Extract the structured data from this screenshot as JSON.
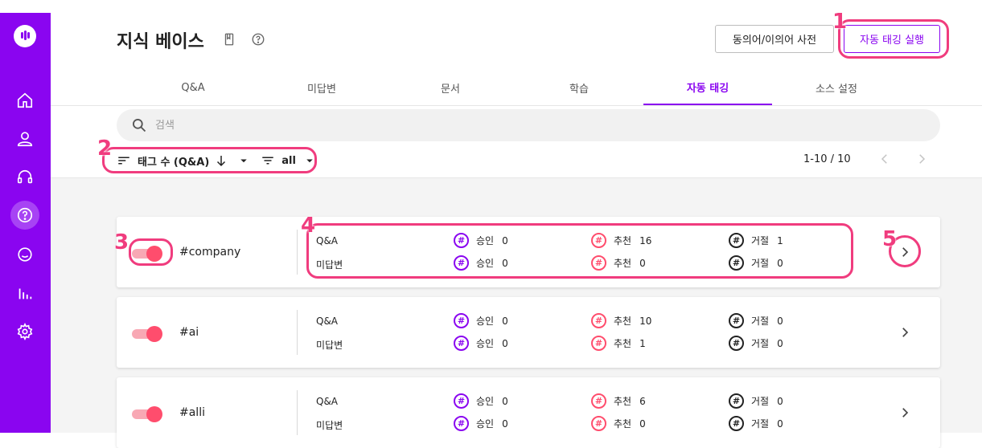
{
  "header": {
    "title": "지식 베이스",
    "synonym_button": "동의어/이의어 사전",
    "autotag_button": "자동 태깅 실행"
  },
  "tabs": [
    "Q&A",
    "미답변",
    "문서",
    "학습",
    "자동 태깅",
    "소스 설정"
  ],
  "active_tab": "자동 태깅",
  "search": {
    "placeholder": "검색"
  },
  "filters": {
    "sort_label": "태그 수 (Q&A)",
    "status_label": "all"
  },
  "pagination": {
    "range": "1-10 / 10"
  },
  "stat_labels": {
    "approve": "승인",
    "recommend": "추천",
    "reject": "거절"
  },
  "row_labels": {
    "qa": "Q&A",
    "unanswered": "미답변"
  },
  "tags": [
    {
      "name": "#company",
      "enabled": true,
      "qa": {
        "approve": "0",
        "recommend": "16",
        "reject": "1"
      },
      "unanswered": {
        "approve": "0",
        "recommend": "0",
        "reject": "0"
      }
    },
    {
      "name": "#ai",
      "enabled": true,
      "qa": {
        "approve": "0",
        "recommend": "10",
        "reject": "0"
      },
      "unanswered": {
        "approve": "0",
        "recommend": "1",
        "reject": "0"
      }
    },
    {
      "name": "#alli",
      "enabled": true,
      "qa": {
        "approve": "0",
        "recommend": "6",
        "reject": "0"
      },
      "unanswered": {
        "approve": "0",
        "recommend": "0",
        "reject": "0"
      }
    }
  ],
  "annotations": [
    "1",
    "2",
    "3",
    "4",
    "5"
  ],
  "colors": {
    "brand": "#8a05f0",
    "recommend": "#ff4d6d",
    "highlight": "#f03c7e"
  }
}
